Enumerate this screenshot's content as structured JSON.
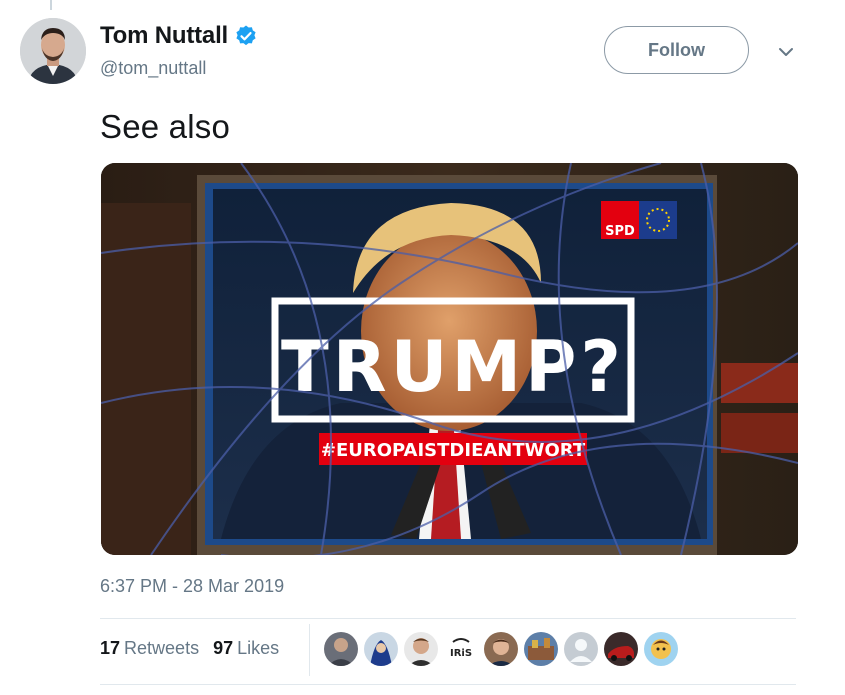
{
  "tweet": {
    "author_name": "Tom Nuttall",
    "author_handle": "@tom_nuttall",
    "follow_label": "Follow",
    "text": "See also",
    "timestamp": "6:37 PM - 28 Mar 2019"
  },
  "media": {
    "poster_headline": "TRUMP?",
    "poster_hashtag": "#EUROPAISTDIEANTWORT",
    "poster_logo": "SPD"
  },
  "stats": {
    "retweets_count": "17",
    "retweets_label": "Retweets",
    "likes_count": "97",
    "likes_label": "Likes"
  },
  "likers": {
    "iris_label": "IRiS"
  },
  "colors": {
    "verified_blue": "#1da1f2",
    "secondary_text": "#657786",
    "spd_red": "#e3000f"
  }
}
